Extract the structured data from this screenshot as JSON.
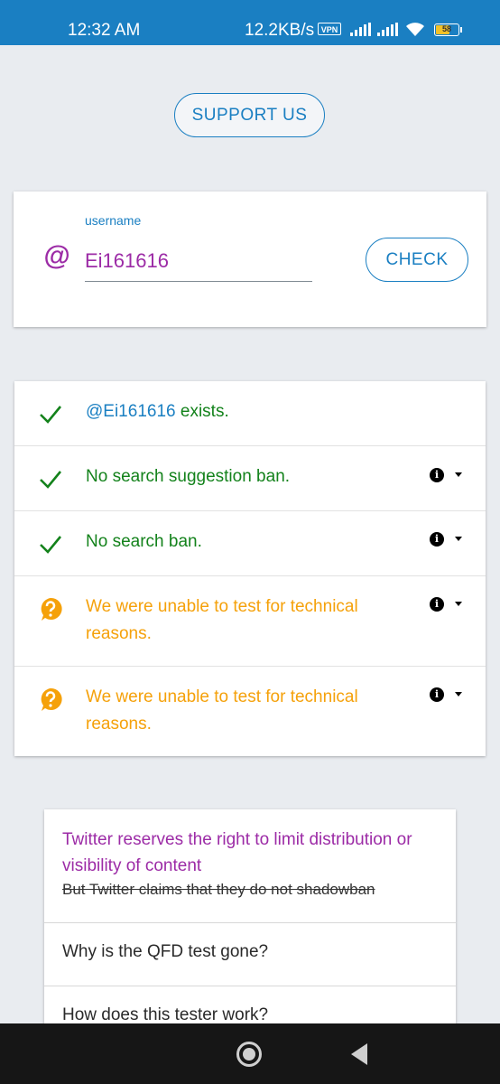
{
  "status_bar": {
    "time": "12:32 AM",
    "network_speed": "12.2KB/s",
    "vpn_label": "VPN",
    "battery_level": "58",
    "icons": [
      "signal-icon",
      "signal-icon",
      "wifi-icon",
      "battery-icon"
    ]
  },
  "support_button": {
    "label": "SUPPORT US"
  },
  "username_card": {
    "at_symbol": "@",
    "label": "username",
    "value": "Ei161616",
    "check_label": "CHECK"
  },
  "results": [
    {
      "status": "ok",
      "handle": "@Ei161616",
      "text": " exists.",
      "has_info": false
    },
    {
      "status": "ok",
      "text": "No search suggestion ban.",
      "has_info": true
    },
    {
      "status": "ok",
      "text": "No search ban.",
      "has_info": true
    },
    {
      "status": "unknown",
      "text": "We were unable to test for technical reasons.",
      "has_info": true
    },
    {
      "status": "unknown",
      "text": "We were unable to test for technical reasons.",
      "has_info": true
    }
  ],
  "info_glyph": "i",
  "faq": [
    {
      "question": "Twitter reserves the right to limit distribution or visibility of content",
      "note": "But Twitter claims that they do not shadowban"
    },
    {
      "question": "Why is the QFD test gone?"
    },
    {
      "question": "How does this tester work?"
    }
  ],
  "colors": {
    "primary": "#1a7fc2",
    "accent": "#9c2ba6",
    "success": "#13821b",
    "warning": "#f5a10a"
  }
}
